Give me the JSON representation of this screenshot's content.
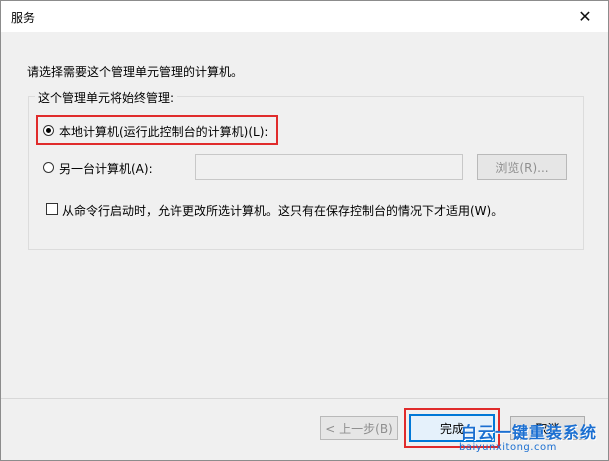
{
  "window": {
    "title": "服务"
  },
  "dialog": {
    "prompt": "请选择需要这个管理单元管理的计算机。",
    "group_label": "这个管理单元将始终管理:",
    "radio_local": {
      "label": "本地计算机(运行此控制台的计算机)(L):",
      "checked": true
    },
    "radio_other": {
      "label": "另一台计算机(A):",
      "checked": false,
      "field_value": ""
    },
    "browse_button": "浏览(R)...",
    "checkbox_allow_change": {
      "label": "从命令行启动时，允许更改所选计算机。这只有在保存控制台的情况下才适用(W)。",
      "checked": false
    }
  },
  "footer": {
    "back_button": "< 上一步(B)",
    "finish_button": "完成",
    "cancel_button": "取消"
  },
  "watermark": {
    "text": "白云一键重装系统",
    "url": "baiyunxitong.com"
  },
  "colors": {
    "highlight": "#e02b2b",
    "focus_border": "#0078d7",
    "watermark": "#1b6fd1"
  }
}
